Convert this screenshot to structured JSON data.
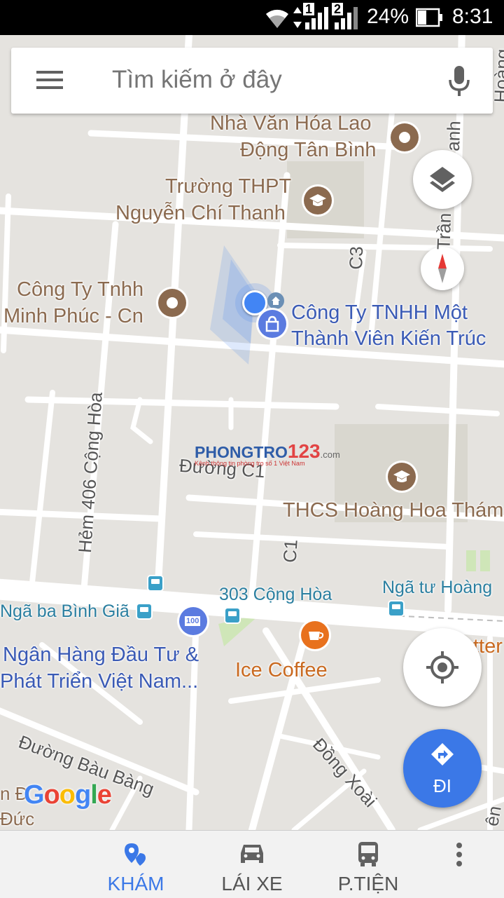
{
  "status_bar": {
    "battery": "24%",
    "time": "8:31",
    "sim1": "1",
    "sim2": "2"
  },
  "search": {
    "placeholder": "Tìm kiếm ở đây"
  },
  "map": {
    "pois": {
      "nha_van_hoa_line1": "Nhà Văn Hóa Lao",
      "nha_van_hoa_line2": "Động Tân Bình",
      "truong_line1": "Trường THPT",
      "truong_line2": "Nguyễn Chí Thanh",
      "minh_phuc_line1": "Công Ty Tnhh",
      "minh_phuc_line2": "Minh Phúc - Cn",
      "kien_truc_line1": "Công Ty TNHH Một",
      "kien_truc_line2": "Thành Viên Kiến Trúc",
      "thcs": "THCS Hoàng Hoa Thám",
      "ngan_hang_line1": "Ngân Hàng Đầu Tư &",
      "ngan_hang_line2": "Phát Triển Việt Nam...",
      "ice_coffee": "Ice Coffee",
      "partial_right": "tter"
    },
    "transit": {
      "cong_hoa_303": "303 Cộng Hòa",
      "nga_tu_hoang": "Ngã tư Hoàng",
      "nga_ba_binh_gia": "Ngã ba Bình Giã"
    },
    "roads": {
      "c3": "C3",
      "c1": "C1",
      "duong_c1": "Đường C1",
      "hem_406": "Hẻm 406 Cộng Hòa",
      "bau_bang": "Đường Bàu Bàng",
      "dong_xoai": "Đồng Xoài",
      "tran": "Trần",
      "anh": "anh",
      "hoang_top": "Hoàng",
      "left_bottom_1": "n Đ",
      "left_bottom_2": "Đức",
      "right_bottom": "ên"
    },
    "watermark": {
      "brand1": "PHONGTRO",
      "brand2": "123",
      "suffix": ".com",
      "tagline": "Kênh thông tin phòng trọ số 1 Việt Nam"
    },
    "google": [
      "G",
      "o",
      "o",
      "g",
      "l",
      "e"
    ],
    "bank_badge": "100"
  },
  "directions_fab": {
    "label": "ĐI"
  },
  "bottom_nav": [
    {
      "label": "KHÁM",
      "icon": "explore-pin-icon",
      "active": true
    },
    {
      "label": "LÁI XE",
      "icon": "car-icon",
      "active": false
    },
    {
      "label": "P.TIỆN",
      "icon": "bus-icon",
      "active": false
    }
  ],
  "colors": {
    "accent": "#3b78e7",
    "poi_brown": "#8b6a4f",
    "poi_blue": "#3a5ab5",
    "poi_orange": "#c9691f",
    "map_bg": "#e5e3df"
  }
}
